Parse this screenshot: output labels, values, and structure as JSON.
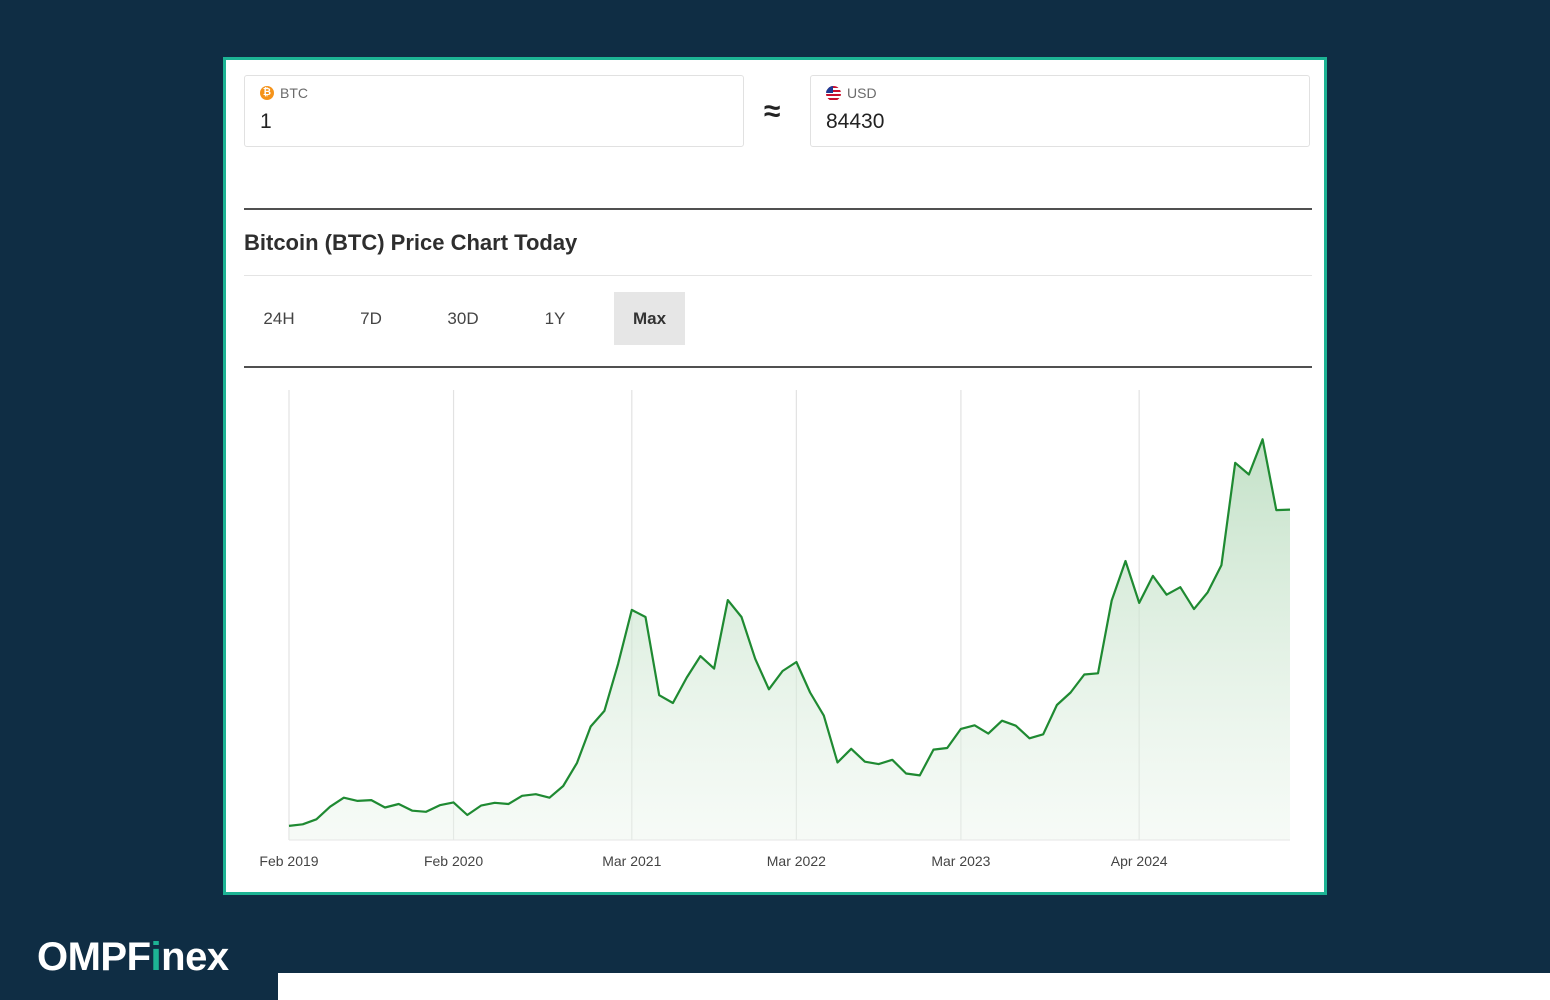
{
  "converter": {
    "from": {
      "currency": "BTC",
      "value": "1"
    },
    "approx_symbol": "≈",
    "to": {
      "currency": "USD",
      "value": "84430"
    }
  },
  "chart_section": {
    "title": "Bitcoin (BTC) Price Chart Today",
    "tabs": [
      {
        "label": "24H",
        "active": false
      },
      {
        "label": "7D",
        "active": false
      },
      {
        "label": "30D",
        "active": false
      },
      {
        "label": "1Y",
        "active": false
      },
      {
        "label": "Max",
        "active": true
      }
    ]
  },
  "colors": {
    "accent": "#1db394",
    "line": "#1f8a32",
    "fill": "#cfe6d2",
    "background": "#0f2d44"
  },
  "icons": {
    "btc": "bitcoin-coin-icon",
    "usd": "us-flag-icon"
  },
  "chart_data": {
    "type": "area",
    "x_ticks": [
      "Feb 2019",
      "Feb 2020",
      "Mar 2021",
      "Mar 2022",
      "Mar 2023",
      "Apr 2024"
    ],
    "grid": "vertical",
    "x": [
      "2019-02",
      "2019-03",
      "2019-04",
      "2019-05",
      "2019-06",
      "2019-07",
      "2019-08",
      "2019-09",
      "2019-10",
      "2019-11",
      "2019-12",
      "2020-01",
      "2020-02",
      "2020-03",
      "2020-04",
      "2020-05",
      "2020-06",
      "2020-07",
      "2020-08",
      "2020-09",
      "2020-10",
      "2020-11",
      "2020-12",
      "2021-01",
      "2021-02",
      "2021-03",
      "2021-04",
      "2021-05",
      "2021-06",
      "2021-07",
      "2021-08",
      "2021-09",
      "2021-10",
      "2021-11",
      "2021-12",
      "2022-01",
      "2022-02",
      "2022-03",
      "2022-04",
      "2022-05",
      "2022-06",
      "2022-07",
      "2022-08",
      "2022-09",
      "2022-10",
      "2022-11",
      "2022-12",
      "2023-01",
      "2023-02",
      "2023-03",
      "2023-04",
      "2023-05",
      "2023-06",
      "2023-07",
      "2023-08",
      "2023-09",
      "2023-10",
      "2023-11",
      "2023-12",
      "2024-01",
      "2024-02",
      "2024-03",
      "2024-04",
      "2024-05",
      "2024-06",
      "2024-07",
      "2024-08",
      "2024-09",
      "2024-10",
      "2024-11",
      "2024-12",
      "2025-01",
      "2025-02",
      "2025-03"
    ],
    "values": [
      3600,
      4000,
      5300,
      8500,
      10800,
      10000,
      10200,
      8300,
      9200,
      7500,
      7200,
      8900,
      9600,
      6400,
      8800,
      9500,
      9200,
      11300,
      11700,
      10800,
      13800,
      19700,
      29000,
      33000,
      45000,
      58800,
      57000,
      37000,
      35000,
      41500,
      47000,
      43800,
      61300,
      57000,
      46300,
      38500,
      43200,
      45500,
      37700,
      31800,
      19800,
      23300,
      20000,
      19400,
      20500,
      17000,
      16500,
      23100,
      23500,
      28400,
      29300,
      27200,
      30500,
      29200,
      26000,
      27000,
      34500,
      37700,
      42300,
      42600,
      61200,
      71300,
      60600,
      67500,
      62700,
      64600,
      59000,
      63300,
      70200,
      96400,
      93400,
      102400,
      84300,
      84430
    ],
    "ylim": [
      0,
      115000
    ]
  }
}
